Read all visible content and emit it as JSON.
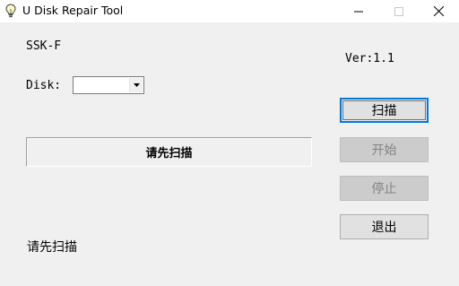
{
  "window": {
    "title": "U Disk Repair Tool",
    "icon": "lightbulb-icon"
  },
  "device": {
    "model": "SSK-F",
    "version": "Ver:1.1"
  },
  "disk_select": {
    "label": "Disk:",
    "value": ""
  },
  "status_panel": {
    "text": "请先扫描"
  },
  "buttons": {
    "scan": "扫描",
    "start": "开始",
    "stop": "停止",
    "exit": "退出"
  },
  "status_bar": {
    "text": "请先扫描"
  },
  "colors": {
    "focus_border": "#0078d7",
    "disabled_text": "#838383"
  }
}
